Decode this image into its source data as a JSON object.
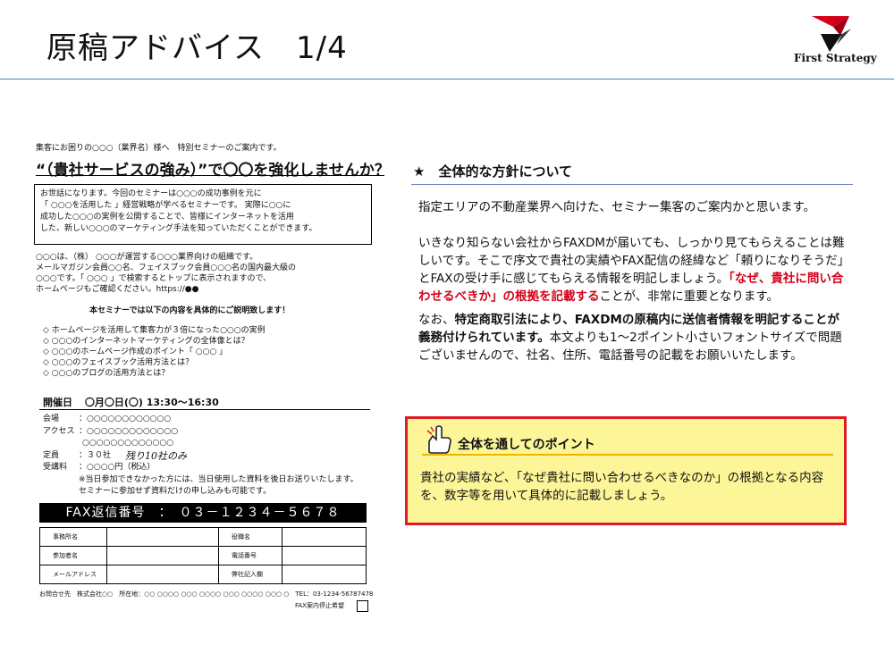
{
  "header": {
    "title": "原稿アドバイス　1/4",
    "logo_text": "First Strategy"
  },
  "fax": {
    "intro": "集客にお困りの○○○（業界名）様へ　特別セミナーのご案内です。",
    "headline": "“（貴社サービスの強み）”で〇〇を強化しませんか？",
    "greeting": [
      "お世話になります。今回のセミナーは○○○の成功事例を元に",
      "「 ○○○を活用した 」経営戦略が学べるセミナーです。 実際に○○に",
      "成功した○○○の実例を公開することで、皆様にインターネットを活用",
      "した、新しい○○○のマーケティング手法を知っていただくことができます。"
    ],
    "company": [
      "○○○は、（株） ○○○が運営する○○○業界向けの組織です。",
      "メールマガジン会員○○名、フェイスブック会員○○○名の国内最大級の",
      "○○○です。「 ○○○ 」で検索するとトップに表示されますので、",
      "ホームページもご確認ください。https://●●"
    ],
    "content_title": "本セミナーでは以下の内容を具体的にご説明致します！",
    "bullets": [
      "◇ ホームページを活用して集客力が３倍になった○○○の実例",
      "◇ ○○○のインターネットマーケティングの全体像とは？",
      "◇ ○○○のホームページ作成のポイント「 ○○○ 」",
      "◇ ○○○のフェイスブック活用方法とは？",
      "◇ ○○○のブログの活用方法とは？"
    ],
    "date_label": "開催日",
    "date_value": "〇月〇日(〇) 13:30～16:30",
    "venue_label": "会場",
    "venue_value": "：○○○○○○○○○○○○",
    "access_label": "アクセス",
    "access_value1": "：○○○○○○○○○○○○○",
    "access_value2": "○○○○○○○○○○○○○",
    "capacity_label": "定員",
    "capacity_value": "：３０社",
    "capacity_note": "残り10社のみ",
    "fee_label": "受講料",
    "fee_value": "：○○○○円（税込）",
    "notes": [
      "※当日参加できなかった方には、当日使用した資料を後日お送りいたします。",
      "セミナーに参加せず資料だけの申し込みも可能です。"
    ],
    "fax_number": "FAX返信番号　：　０３－１２３４－５６７８",
    "form": {
      "company_name": "事務所名",
      "position": "役職名",
      "attendee": "参加者名",
      "phone": "電話番号",
      "email": "メールアドレス",
      "stamp": "弊社記入欄"
    },
    "contact": "お問合せ先　株式会社○○　所在地：○○ ○○○○ ○○○ ○○○○ ○○○ ○○○○ ○○○ ○　TEL：03-1234-56787478",
    "stop_label": "FAX案内停止希望"
  },
  "advice": {
    "section_title": "★　全体的な方針について",
    "p1": "指定エリアの不動産業界へ向けた、セミナー集客のご案内かと思います。",
    "p2_a": "いきなり知らない会社からFAXDMが届いても、しっかり見てもらえることは難しいです。そこで序文で貴社の実績やFAX配信の経緯など「頼りになりそうだ」とFAXの受け手に感じてもらえる情報を明記しましょう。",
    "p2_red": "「なぜ、貴社に問い合わせるべきか」の根拠を記載する",
    "p2_b": "ことが、非常に重要となります。",
    "p3_a": "なお、",
    "p3_bold": "特定商取引法により、FAXDMの原稿内に送信者情報を明記することが義務付けられています。",
    "p3_b": "本文よりも1～2ポイント小さいフォントサイズで問題ございませんので、社名、住所、電話番号の記載をお願いいたします。",
    "callout_title": "全体を通してのポイント",
    "callout_body": "貴社の実績など、「なぜ貴社に問い合わせるべきなのか」の根拠となる内容を、数字等を用いて具体的に記載しましょう。"
  },
  "colors": {
    "accent_red": "#e01b24",
    "callout_bg": "#fdf699",
    "rule_blue": "#4a7cc0"
  }
}
